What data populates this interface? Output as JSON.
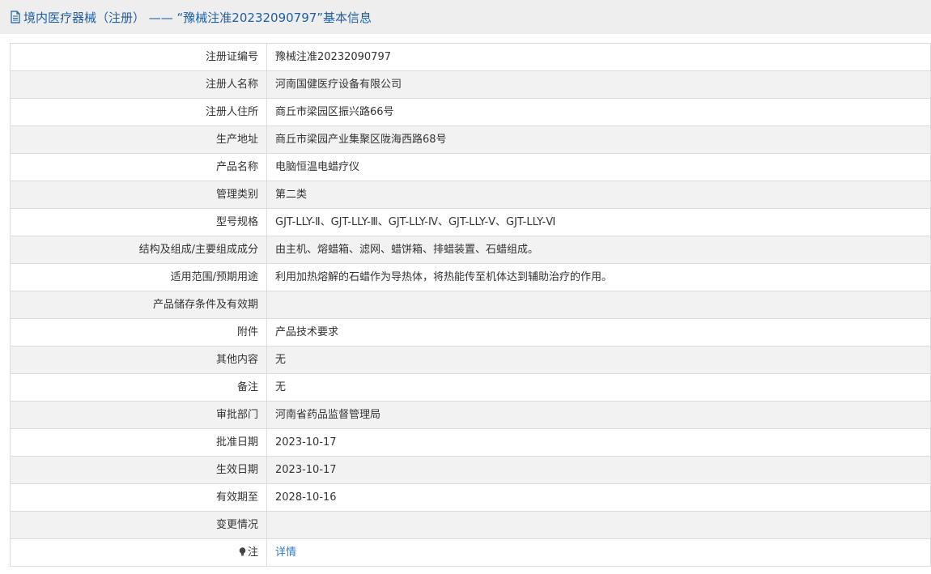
{
  "header": {
    "title": "境内医疗器械（注册） —— “豫械注准20232090797”基本信息"
  },
  "rows": [
    {
      "label": "注册证编号",
      "value": "豫械注准20232090797"
    },
    {
      "label": "注册人名称",
      "value": "河南国健医疗设备有限公司"
    },
    {
      "label": "注册人住所",
      "value": "商丘市梁园区振兴路66号"
    },
    {
      "label": "生产地址",
      "value": "商丘市梁园产业集聚区陇海西路68号"
    },
    {
      "label": "产品名称",
      "value": "电脑恒温电蜡疗仪"
    },
    {
      "label": "管理类别",
      "value": "第二类"
    },
    {
      "label": "型号规格",
      "value": "GJT-LLY-Ⅱ、GJT-LLY-Ⅲ、GJT-LLY-Ⅳ、GJT-LLY-Ⅴ、GJT-LLY-Ⅵ"
    },
    {
      "label": "结构及组成/主要组成成分",
      "value": "由主机、熔蜡箱、滤网、蜡饼箱、排蜡装置、石蜡组成。"
    },
    {
      "label": "适用范围/预期用途",
      "value": "利用加热熔解的石蜡作为导热体，将热能传至机体达到辅助治疗的作用。"
    },
    {
      "label": "产品储存条件及有效期",
      "value": ""
    },
    {
      "label": "附件",
      "value": "产品技术要求"
    },
    {
      "label": "其他内容",
      "value": "无"
    },
    {
      "label": "备注",
      "value": "无"
    },
    {
      "label": "审批部门",
      "value": "河南省药品监督管理局"
    },
    {
      "label": "批准日期",
      "value": "2023-10-17"
    },
    {
      "label": "生效日期",
      "value": "2023-10-17"
    },
    {
      "label": "有效期至",
      "value": "2028-10-16"
    },
    {
      "label": "变更情况",
      "value": ""
    }
  ],
  "note_row": {
    "label": "注",
    "link_text": "详情",
    "icon": "lightbulb-icon"
  },
  "colors": {
    "title_text": "#1d5fa8",
    "link": "#2f7bd6",
    "header_bg": "#eeeeee",
    "row_alt_bg": "#f2f2f2",
    "border": "#dcdcdc"
  }
}
